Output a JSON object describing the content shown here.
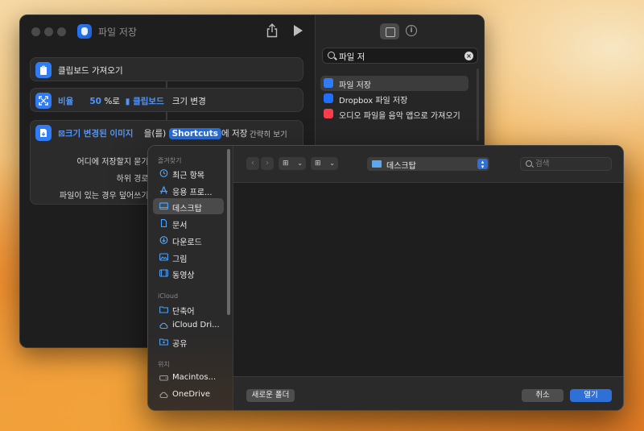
{
  "shortcuts_window": {
    "title": "파일 저장",
    "actions": {
      "get_clipboard": "클립보드 가져오기",
      "resize": {
        "ratio_label": "비율",
        "ratio_value": "50",
        "ratio_unit": "%로",
        "input_token": "클립보드",
        "verb": "크기 변경"
      },
      "save": {
        "input_token": "크기 변경된 이미지",
        "particle": "을(를)",
        "destination_token": "Shortcuts",
        "verb": "에 저장",
        "show_less": "간략히 보기",
        "param_ask_where": "어디에 저장할지 묻기:",
        "param_subpath": "하위 경로:",
        "param_overwrite": "파일이 있는 경우 덮어쓰기:"
      }
    },
    "search": {
      "value": "파일 저"
    },
    "results": [
      {
        "label": "파일 저장",
        "icon": "shortcuts-icon",
        "color": "#2f7cf6"
      },
      {
        "label": "Dropbox 파일 저장",
        "icon": "dropbox-icon",
        "color": "#1f6fff"
      },
      {
        "label": "오디오 파일을 음악 앱으로 가져오기",
        "icon": "music-icon",
        "color": "#fa3c4c"
      }
    ]
  },
  "save_dialog": {
    "sidebar": {
      "favorites_heading": "즐겨찾기",
      "favorites": [
        {
          "label": "최근 항목",
          "icon": "clock-icon"
        },
        {
          "label": "응용 프로...",
          "icon": "apps-icon"
        },
        {
          "label": "데스크탑",
          "icon": "desktop-icon"
        },
        {
          "label": "문서",
          "icon": "document-icon"
        },
        {
          "label": "다운로드",
          "icon": "download-icon"
        },
        {
          "label": "그림",
          "icon": "pictures-icon"
        },
        {
          "label": "동영상",
          "icon": "movies-icon"
        }
      ],
      "icloud_heading": "iCloud",
      "icloud": [
        {
          "label": "단축어",
          "icon": "shortcuts-folder-icon"
        },
        {
          "label": "iCloud Dri...",
          "icon": "cloud-icon"
        },
        {
          "label": "공유",
          "icon": "shared-folder-icon"
        }
      ],
      "locations_heading": "위치",
      "locations": [
        {
          "label": "Macintos...",
          "icon": "disk-icon"
        },
        {
          "label": "OneDrive",
          "icon": "cloud-icon"
        }
      ]
    },
    "location": "데스크탑",
    "search_placeholder": "검색",
    "new_folder_label": "새로운 폴더",
    "cancel_label": "취소",
    "open_label": "열기",
    "accent_color": "#2f6fd8"
  }
}
